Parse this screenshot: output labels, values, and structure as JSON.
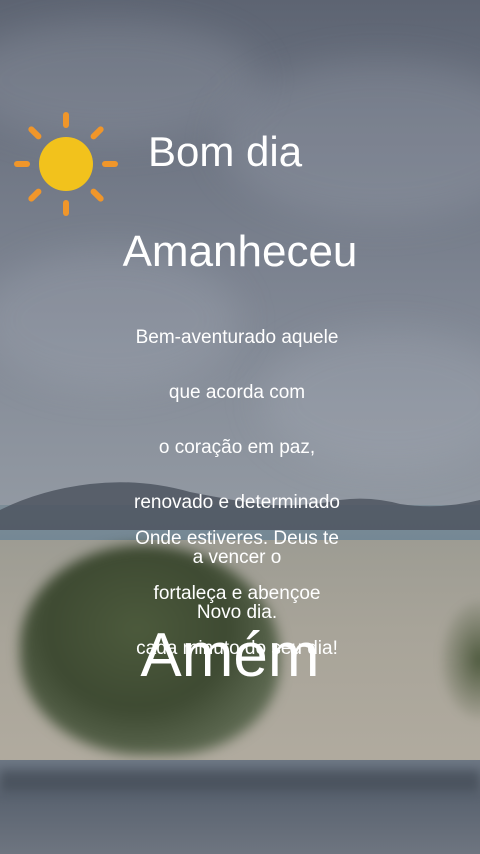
{
  "greeting": "Bom dia",
  "title": "Amanheceu",
  "message_lines": [
    "Bem-aventurado aquele",
    "que acorda com",
    "o coração em paz,",
    "renovado e determinado",
    "a vencer o",
    "Novo dia."
  ],
  "blessing_lines": [
    "Onde estiveres. Deus te",
    "fortaleça e abençoe",
    "cada minuto do seu dia!"
  ],
  "closing": "Amém",
  "icons": {
    "sun": "sun-icon"
  },
  "colors": {
    "text": "#ffffff",
    "sun_core": "#f2c21c",
    "sun_rays": "#f0962a"
  }
}
